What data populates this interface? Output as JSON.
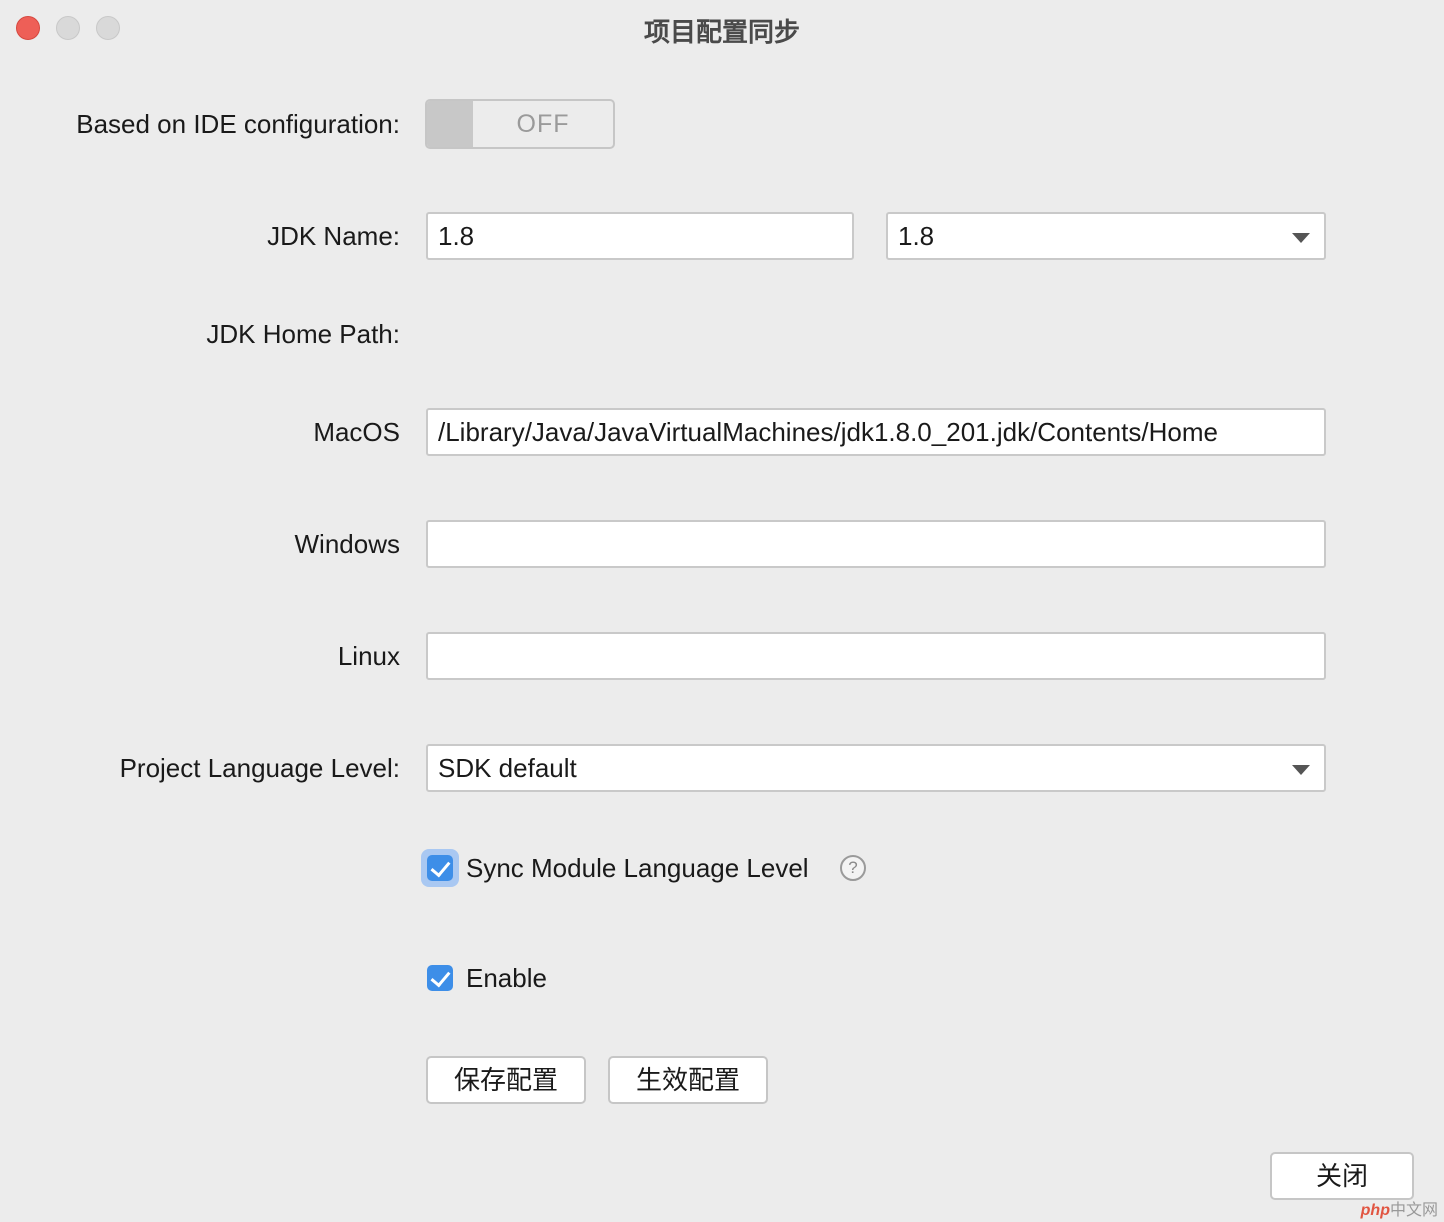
{
  "window": {
    "title": "项目配置同步"
  },
  "ide_config": {
    "label": "Based on IDE configuration:",
    "toggle_state": "OFF"
  },
  "jdk_name": {
    "label": "JDK Name:",
    "input_value": "1.8",
    "select_value": "1.8"
  },
  "jdk_home": {
    "label": "JDK Home Path:"
  },
  "macos": {
    "label": "MacOS",
    "value": "/Library/Java/JavaVirtualMachines/jdk1.8.0_201.jdk/Contents/Home"
  },
  "windows": {
    "label": "Windows",
    "value": ""
  },
  "linux": {
    "label": "Linux",
    "value": ""
  },
  "language_level": {
    "label": "Project Language Level:",
    "value": "SDK default"
  },
  "sync_module": {
    "label": "Sync Module Language Level",
    "checked": true,
    "help": "?"
  },
  "enable": {
    "label": "Enable",
    "checked": true
  },
  "buttons": {
    "save": "保存配置",
    "apply": "生效配置",
    "close": "关闭"
  },
  "watermark": {
    "brand": "php",
    "site": "中文网"
  }
}
